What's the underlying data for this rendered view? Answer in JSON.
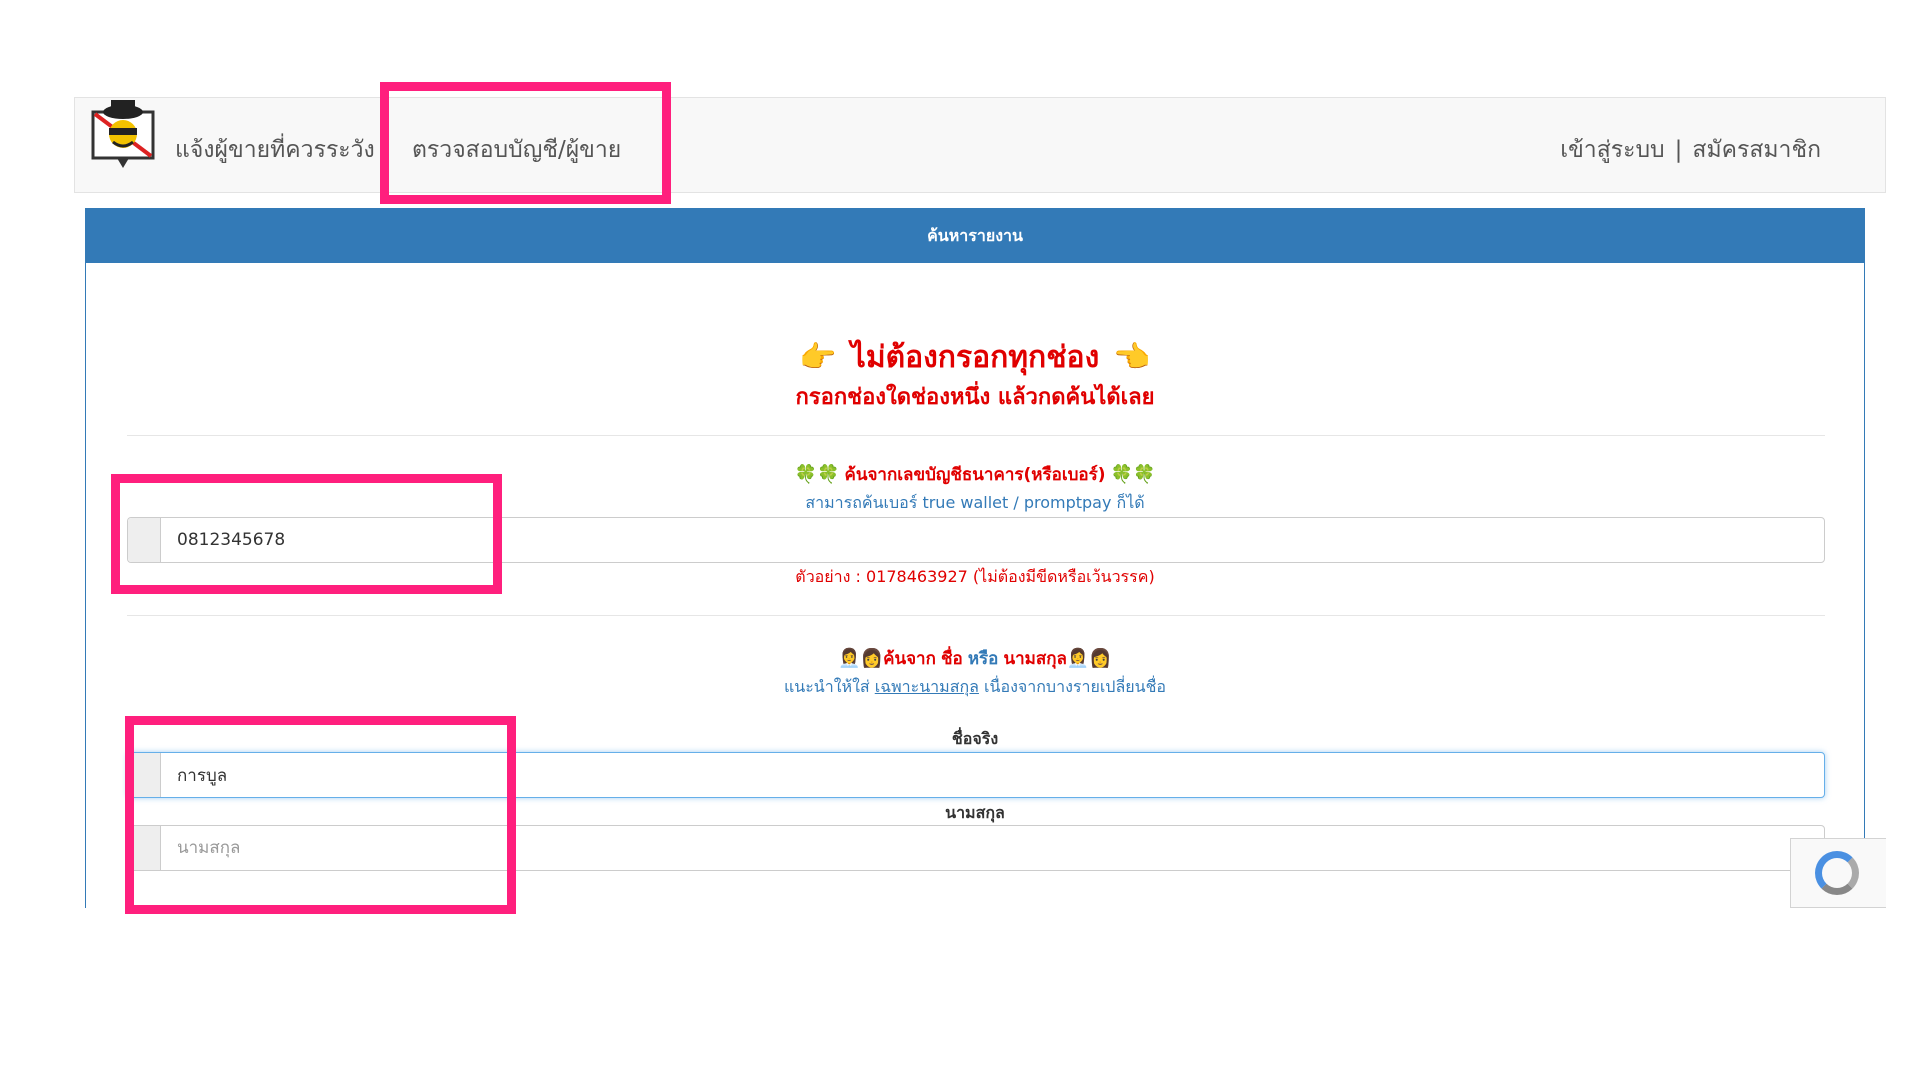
{
  "navbar": {
    "brand": "แจ้งผู้ขายที่ควรระวัง",
    "check_link": "ตรวจสอบบัญชี/ผู้ขาย",
    "login": "เข้าสู่ระบบ",
    "separator": "|",
    "register": "สมัครสมาชิก",
    "logo_icon": "spy-logo-icon"
  },
  "panel": {
    "heading": "ค้นหารายงาน",
    "title_main": "ไม่ต้องกรอกทุกช่อง",
    "title_sub": "กรอกช่องใดช่องหนึ่ง แล้วกดค้นได้เลย",
    "hand_left": "👉",
    "hand_right": "👈"
  },
  "account_search": {
    "clover": "🍀🍀",
    "title": "ค้นจากเลขบัญชีธนาคาร(หรือเบอร์)",
    "note": "สามารถค้นเบอร์ true wallet / promptpay ก็ได้",
    "value": "0812345678",
    "example": "ตัวอย่าง : 0178463927 (ไม่ต้องมีขีดหรือเว้นวรรค)"
  },
  "name_search": {
    "people": "👩‍💼👩",
    "title_prefix": "ค้นจาก",
    "title_first": "ชื่อ",
    "title_or": "หรือ",
    "title_last": "นามสกุล",
    "note_prefix": "แนะนำให้ใส่",
    "note_link": "เฉพาะนามสกุล",
    "note_suffix": "เนื่องจากบางรายเปลี่ยนชื่อ",
    "first_label": "ชื่อจริง",
    "first_value": "การบูล",
    "last_label": "นามสกุล",
    "last_placeholder": "นามสกุล"
  },
  "colors": {
    "panel_blue": "#337ab7",
    "highlight": "#ff1f7d",
    "red_text": "#e00000"
  }
}
